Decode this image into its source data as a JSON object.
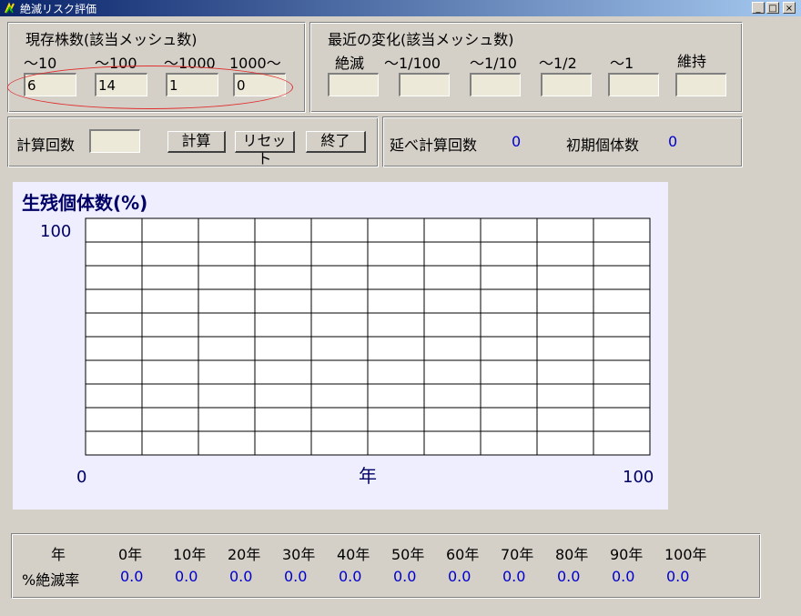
{
  "window": {
    "title": "絶滅リスク評価",
    "controls": {
      "minimize": "_",
      "maximize": "□",
      "close": "×"
    }
  },
  "current": {
    "title": "現存株数(該当メッシュ数)",
    "labels": [
      "〜10",
      "〜100",
      "〜1000",
      "1000〜"
    ],
    "values": [
      "6",
      "14",
      "1",
      "0"
    ]
  },
  "recent": {
    "title": "最近の変化(該当メッシュ数)",
    "labels": [
      "絶滅",
      "〜1/100",
      "〜1/10",
      "〜1/2",
      "〜1",
      "維持"
    ],
    "values": [
      "",
      "",
      "",
      "",
      "",
      ""
    ]
  },
  "calc": {
    "count_label": "計算回数",
    "count_value": "",
    "compute_label": "計算",
    "reset_label": "リセット",
    "exit_label": "終了"
  },
  "stats": {
    "total_label": "延べ計算回数",
    "total_value": "0",
    "initial_label": "初期個体数",
    "initial_value": "0"
  },
  "chart_data": {
    "type": "line",
    "title": "生残個体数(%)",
    "xlabel": "年",
    "ylabel": "",
    "xlim": [
      0,
      100
    ],
    "ylim": [
      0,
      100
    ],
    "y_tick_top": "100",
    "x_tick_left": "0",
    "x_tick_right": "100",
    "grid": true,
    "grid_cols": 10,
    "grid_rows": 10,
    "series": []
  },
  "table": {
    "header_label": "年",
    "row_label": "%絶滅率",
    "years": [
      "0年",
      "10年",
      "20年",
      "30年",
      "40年",
      "50年",
      "60年",
      "70年",
      "80年",
      "90年",
      "100年"
    ],
    "rates": [
      "0.0",
      "0.0",
      "0.0",
      "0.0",
      "0.0",
      "0.0",
      "0.0",
      "0.0",
      "0.0",
      "0.0",
      "0.0"
    ]
  },
  "colors": {
    "accent_value": "#0000cc",
    "highlight_ellipse": "#e03030",
    "chart_background": "#eeeeff",
    "title_text": "#000066"
  }
}
